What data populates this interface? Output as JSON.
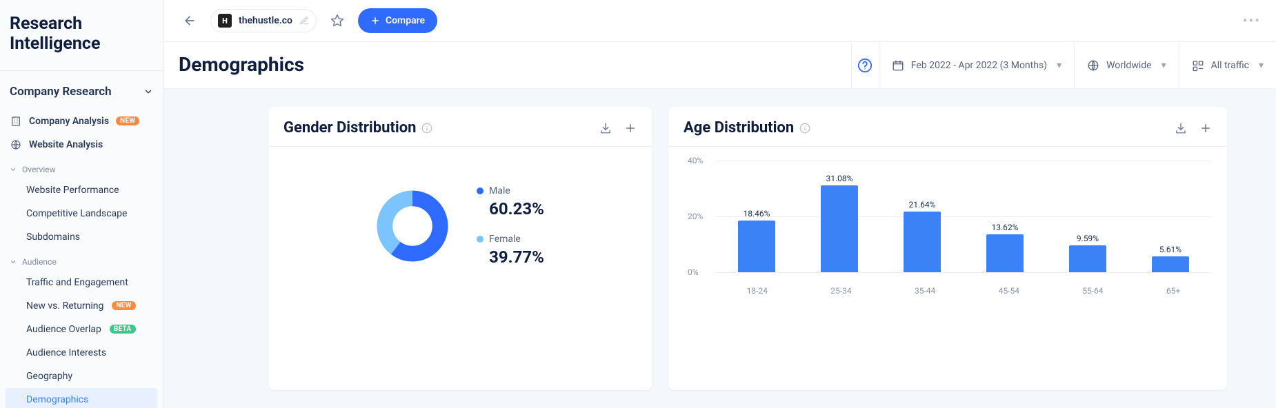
{
  "brand": "Research Intelligence",
  "sidebar": {
    "section_label": "Company Research",
    "links": [
      {
        "label": "Company Analysis",
        "badge": "NEW",
        "icon": "building"
      },
      {
        "label": "Website Analysis",
        "icon": "globe"
      }
    ],
    "groups": [
      {
        "label": "Overview",
        "items": [
          {
            "label": "Website Performance"
          },
          {
            "label": "Competitive Landscape"
          },
          {
            "label": "Subdomains"
          }
        ]
      },
      {
        "label": "Audience",
        "items": [
          {
            "label": "Traffic and Engagement"
          },
          {
            "label": "New vs. Returning",
            "badge": "NEW"
          },
          {
            "label": "Audience Overlap",
            "badge": "BETA"
          },
          {
            "label": "Audience Interests"
          },
          {
            "label": "Geography"
          },
          {
            "label": "Demographics",
            "active": true
          }
        ]
      }
    ]
  },
  "topbar": {
    "domain": "thehustle.co",
    "compare_label": "Compare",
    "favicon_text": "H"
  },
  "titlebar": {
    "page_title": "Demographics",
    "date_label": "Feb 2022 - Apr 2022 (3 Months)",
    "region_label": "Worldwide",
    "traffic_label": "All traffic"
  },
  "cards": {
    "gender_title": "Gender Distribution",
    "age_title": "Age Distribution"
  },
  "chart_data": [
    {
      "type": "pie",
      "title": "Gender Distribution",
      "series": [
        {
          "name": "Male",
          "value": 60.23,
          "color": "#2f6bff",
          "display": "60.23%"
        },
        {
          "name": "Female",
          "value": 39.77,
          "color": "#7cc4ff",
          "display": "39.77%"
        }
      ]
    },
    {
      "type": "bar",
      "title": "Age Distribution",
      "categories": [
        "18-24",
        "25-34",
        "35-44",
        "45-54",
        "55-64",
        "65+"
      ],
      "values": [
        18.46,
        31.08,
        21.64,
        13.62,
        9.59,
        5.61
      ],
      "value_labels": [
        "18.46%",
        "31.08%",
        "21.64%",
        "13.62%",
        "9.59%",
        "5.61%"
      ],
      "ylabel": "",
      "xlabel": "",
      "ylim": [
        0,
        40
      ],
      "yticks": [
        0,
        20,
        40
      ],
      "ytick_labels": [
        "0%",
        "20%",
        "40%"
      ],
      "bar_color": "#3b82f6"
    }
  ]
}
